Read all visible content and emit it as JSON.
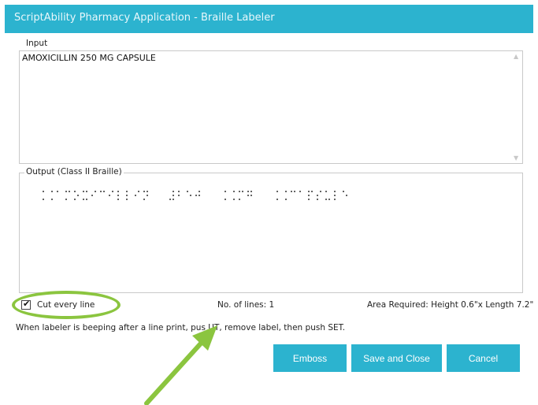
{
  "window": {
    "title": "ScriptAbility Pharmacy Application - Braille Labeler"
  },
  "input": {
    "label": "Input",
    "value": "AMOXICILLIN 250 MG CAPSULE",
    "scroll_up_icon": "scroll-up-arrow",
    "scroll_down_icon": "scroll-down-arrow"
  },
  "output": {
    "label": "Output (Class II Braille)",
    "braille_text": "AMOXICILLIN 250 MG CAPSULE"
  },
  "options": {
    "cut_every_line_label": "Cut every line",
    "cut_every_line_checked": true,
    "lines_label": "No. of lines: 1",
    "area_label": "Area Required: Height 0.6\"x Length 7.2\""
  },
  "hint": "When labeler is beeping after a line print, pus   UT, remove label, then push SET.",
  "buttons": {
    "emboss": "Emboss",
    "save_close": "Save and Close",
    "cancel": "Cancel"
  },
  "annotation": {
    "highlight_color": "#8bc53f",
    "accent_color": "#2cb3cf"
  }
}
